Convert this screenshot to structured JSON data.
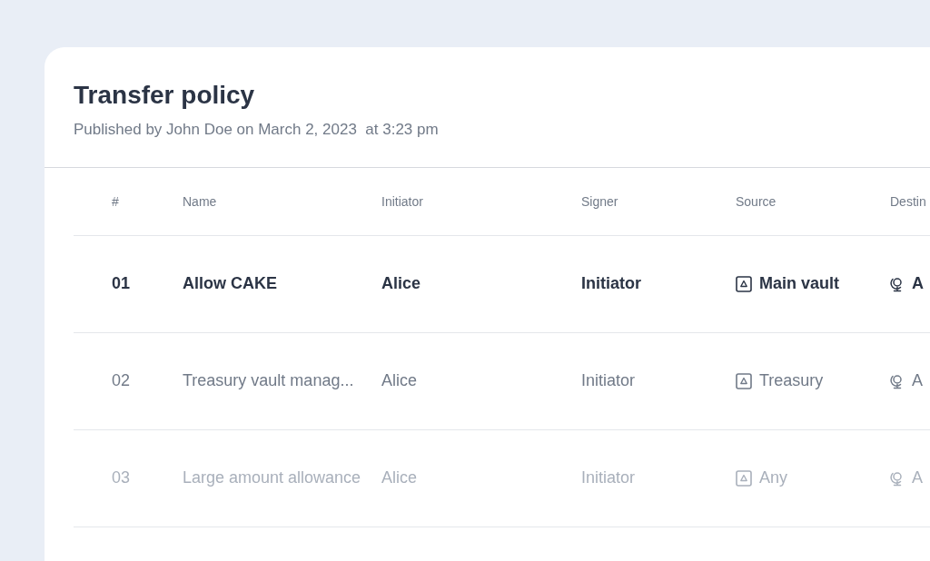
{
  "title": "Transfer policy",
  "subtitle": "Published by John Doe on March 2, 2023  at 3:23 pm",
  "columns": [
    "#",
    "Name",
    "Initiator",
    "Signer",
    "Source",
    "Destin"
  ],
  "rows": [
    {
      "kind": "active",
      "number": "01",
      "name": "Allow CAKE",
      "initiator": "Alice",
      "signer": "Initiator",
      "source": "Main vault",
      "destination": "A"
    },
    {
      "kind": "normal",
      "number": "02",
      "name": "Treasury vault manag...",
      "initiator": "Alice",
      "signer": "Initiator",
      "source": "Treasury",
      "destination": "A"
    },
    {
      "kind": "faded",
      "number": "03",
      "name": "Large amount allowance",
      "initiator": "Alice",
      "signer": "Initiator",
      "source": "Any",
      "destination": "A"
    }
  ]
}
